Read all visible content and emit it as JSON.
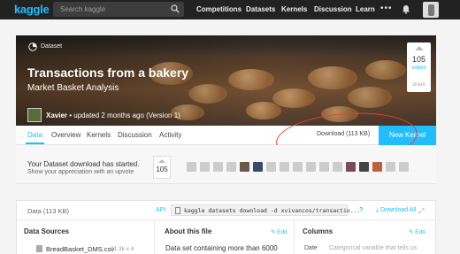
{
  "nav": {
    "logo": "kaggle",
    "search_placeholder": "Search kaggle",
    "links": [
      "Competitions",
      "Datasets",
      "Kernels",
      "Discussion",
      "Learn"
    ],
    "more": "•••"
  },
  "hero": {
    "type_label": "Dataset",
    "title": "Transactions from a bakery",
    "subtitle": "Market Basket Analysis",
    "owner_name": "Xavier",
    "owner_rest": " • updated 2 months ago (Version 1)",
    "votes": "105",
    "votes_label": "voters",
    "share": "share"
  },
  "tabs": {
    "items": [
      "Data",
      "Overview",
      "Kernels",
      "Discussion",
      "Activity"
    ],
    "download_label": "Download (113 KB)",
    "new_kernel": "New Kernel"
  },
  "banner": {
    "line1": "Your Dataset download has started.",
    "line2": "Show your appreciation with an upvote",
    "votes": "105"
  },
  "panel": {
    "data_size": "Data (113 KB)",
    "api": "API",
    "command": "kaggle datasets download -d xvivancos/transactio...",
    "help": "?",
    "download_all": "Download All",
    "expand": "⤢",
    "sources_header": "Data Sources",
    "about_header": "About this file",
    "columns_header": "Columns",
    "edit": "✎ Edit",
    "file_name": "BreadBasket_DMS.csv",
    "file_meta": "21.3k x 4",
    "about_text": "Data set containing more than 6000",
    "column_name": "Date",
    "column_desc": "Categorical variable that tells us"
  },
  "colors": {
    "accent": "#20beff",
    "nav_bg": "#222222",
    "annotation": "#e54033"
  }
}
